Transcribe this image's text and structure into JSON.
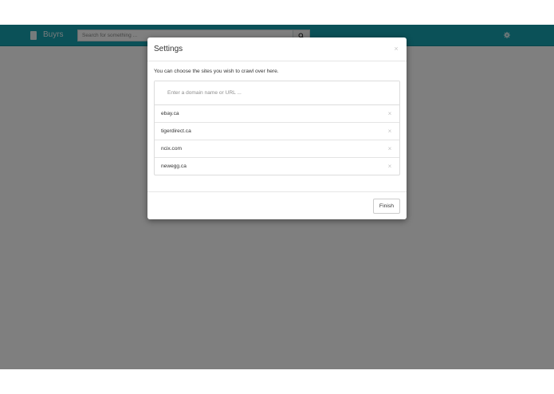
{
  "navbar": {
    "brand": "Buyrs",
    "brand_icon": "bookmark-icon",
    "search_placeholder": "Search for something ...",
    "search_icon": "search-icon",
    "settings_icon": "gear-icon",
    "color": "#17a2b0"
  },
  "modal": {
    "title": "Settings",
    "close_label": "×",
    "description": "You can choose the sites you wish to crawl over here.",
    "domain_input_placeholder": "Enter a domain name or URL ...",
    "sites": [
      {
        "label": "ebay.ca",
        "remove_label": "×"
      },
      {
        "label": "tigerdirect.ca",
        "remove_label": "×"
      },
      {
        "label": "ncix.com",
        "remove_label": "×"
      },
      {
        "label": "newegg.ca",
        "remove_label": "×"
      }
    ],
    "finish_label": "Finish"
  }
}
